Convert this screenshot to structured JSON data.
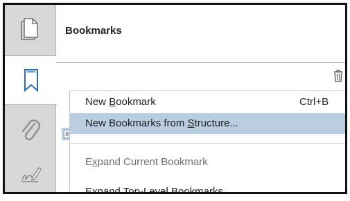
{
  "panel": {
    "title": "Bookmarks"
  },
  "sidebar": {
    "items": [
      {
        "icon": "pages-icon"
      },
      {
        "icon": "bookmark-icon"
      },
      {
        "icon": "paperclip-icon"
      },
      {
        "icon": "signature-icon"
      }
    ]
  },
  "menu": {
    "items": [
      {
        "pre": "New ",
        "u": "B",
        "post": "ookmark",
        "shortcut": "Ctrl+B"
      },
      {
        "pre": "New Bookmarks from ",
        "u": "S",
        "post": "tructure..."
      },
      {
        "pre": "E",
        "u": "x",
        "post": "pand Current Bookmark"
      },
      {
        "pre": "",
        "u": "E",
        "post": "xpand Top-Level Bookmarks"
      }
    ]
  },
  "colors": {
    "highlight": "#b8cde0",
    "sidebar": "#d7d7d7",
    "toolbar_button": "#e7f1f8"
  }
}
